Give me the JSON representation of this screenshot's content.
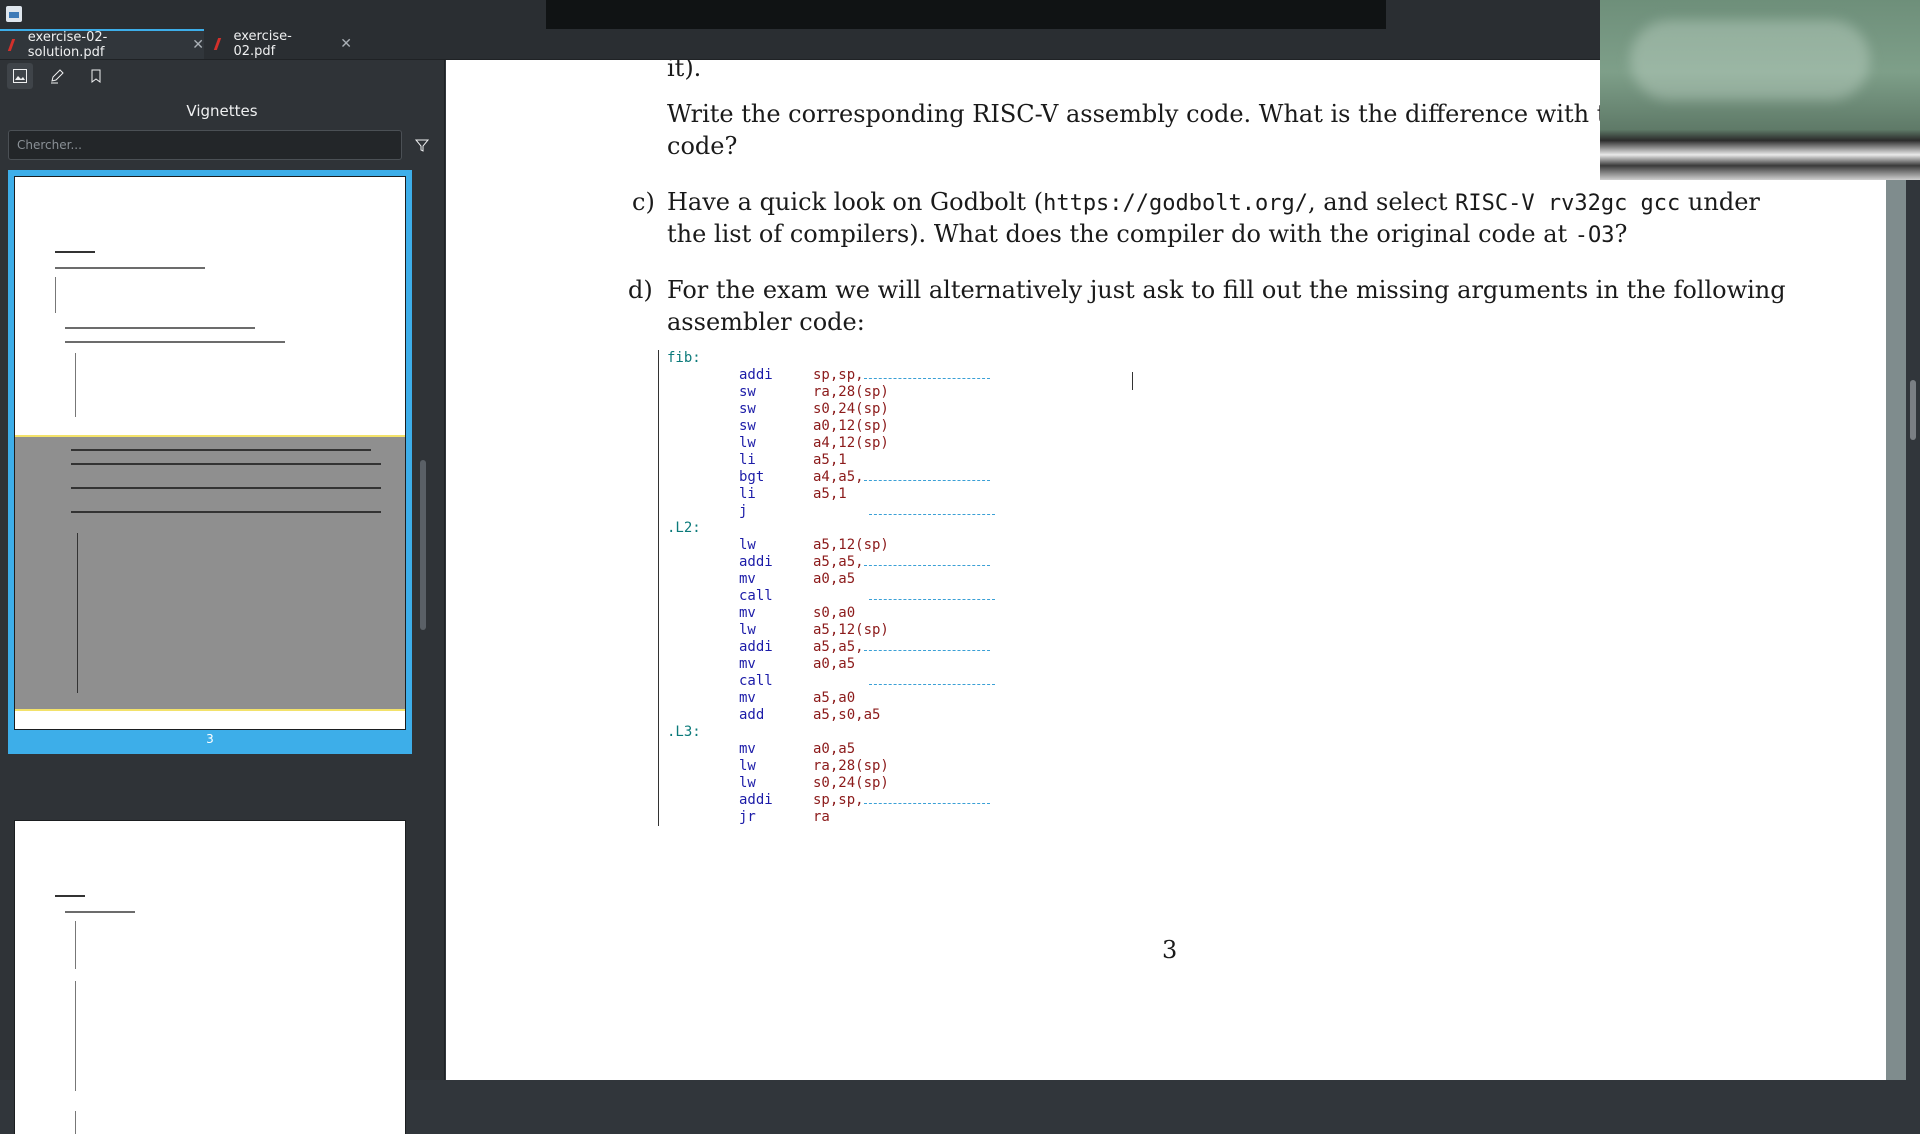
{
  "tabs": [
    {
      "label": "exercise-02-solution.pdf",
      "active": true
    },
    {
      "label": "exercise-02.pdf",
      "active": false
    }
  ],
  "sidebar": {
    "title": "Vignettes",
    "search_placeholder": "Chercher...",
    "tools": [
      "thumbnails-icon",
      "annotate-icon",
      "bookmark-icon"
    ],
    "current_page_label": "3"
  },
  "page": {
    "frag_b_end": "it).",
    "frag_b_q": "Write the corresponding RISC-V assembly code.  What is the difference with t",
    "frag_b_q2": "code?",
    "item_c_label": "c)",
    "item_c_1a": "Have a quick look on Godbolt (",
    "item_c_url": "https://godbolt.org/",
    "item_c_1b": ", and select ",
    "item_c_compiler": "RISC-V rv32gc gcc",
    "item_c_1c": " under",
    "item_c_2a": "the list of compilers).  What does the compiler do with the original code at ",
    "item_c_flag": "-O3",
    "item_c_2b": "?",
    "item_d_label": "d)",
    "item_d_1": "For the exam we will alternatively just ask to fill out the missing arguments in the following",
    "item_d_2": "assembler code:",
    "page_number": "3"
  },
  "code": [
    {
      "label": "fib:",
      "op": "",
      "arg": "",
      "blank": false
    },
    {
      "label": "",
      "op": "addi",
      "arg": "sp,sp,",
      "blank": true
    },
    {
      "label": "",
      "op": "sw",
      "arg": "ra,28(sp)",
      "blank": false
    },
    {
      "label": "",
      "op": "sw",
      "arg": "s0,24(sp)",
      "blank": false
    },
    {
      "label": "",
      "op": "sw",
      "arg": "a0,12(sp)",
      "blank": false
    },
    {
      "label": "",
      "op": "lw",
      "arg": "a4,12(sp)",
      "blank": false
    },
    {
      "label": "",
      "op": "li",
      "arg": "a5,1",
      "blank": false
    },
    {
      "label": "",
      "op": "bgt",
      "arg": "a4,a5,",
      "blank": true
    },
    {
      "label": "",
      "op": "li",
      "arg": "a5,1",
      "blank": false
    },
    {
      "label": "",
      "op": "j",
      "arg": "",
      "blank": true
    },
    {
      "label": ".L2:",
      "op": "",
      "arg": "",
      "blank": false
    },
    {
      "label": "",
      "op": "lw",
      "arg": "a5,12(sp)",
      "blank": false
    },
    {
      "label": "",
      "op": "addi",
      "arg": "a5,a5,",
      "blank": true
    },
    {
      "label": "",
      "op": "mv",
      "arg": "a0,a5",
      "blank": false
    },
    {
      "label": "",
      "op": "call",
      "arg": "",
      "blank": true
    },
    {
      "label": "",
      "op": "mv",
      "arg": "s0,a0",
      "blank": false
    },
    {
      "label": "",
      "op": "lw",
      "arg": "a5,12(sp)",
      "blank": false
    },
    {
      "label": "",
      "op": "addi",
      "arg": "a5,a5,",
      "blank": true
    },
    {
      "label": "",
      "op": "mv",
      "arg": "a0,a5",
      "blank": false
    },
    {
      "label": "",
      "op": "call",
      "arg": "",
      "blank": true
    },
    {
      "label": "",
      "op": "mv",
      "arg": "a5,a0",
      "blank": false
    },
    {
      "label": "",
      "op": "add",
      "arg": "a5,s0,a5",
      "blank": false
    },
    {
      "label": ".L3:",
      "op": "",
      "arg": "",
      "blank": false
    },
    {
      "label": "",
      "op": "mv",
      "arg": "a0,a5",
      "blank": false
    },
    {
      "label": "",
      "op": "lw",
      "arg": "ra,28(sp)",
      "blank": false
    },
    {
      "label": "",
      "op": "lw",
      "arg": "s0,24(sp)",
      "blank": false
    },
    {
      "label": "",
      "op": "addi",
      "arg": "sp,sp,",
      "blank": true
    },
    {
      "label": "",
      "op": "jr",
      "arg": "ra",
      "blank": false
    }
  ],
  "colors": {
    "accent": "#3daee9",
    "code_label": "#0b7a7a",
    "code_op": "#1c1ca8",
    "code_arg": "#8b1a1a",
    "pdf_icon": "#d3302b"
  }
}
